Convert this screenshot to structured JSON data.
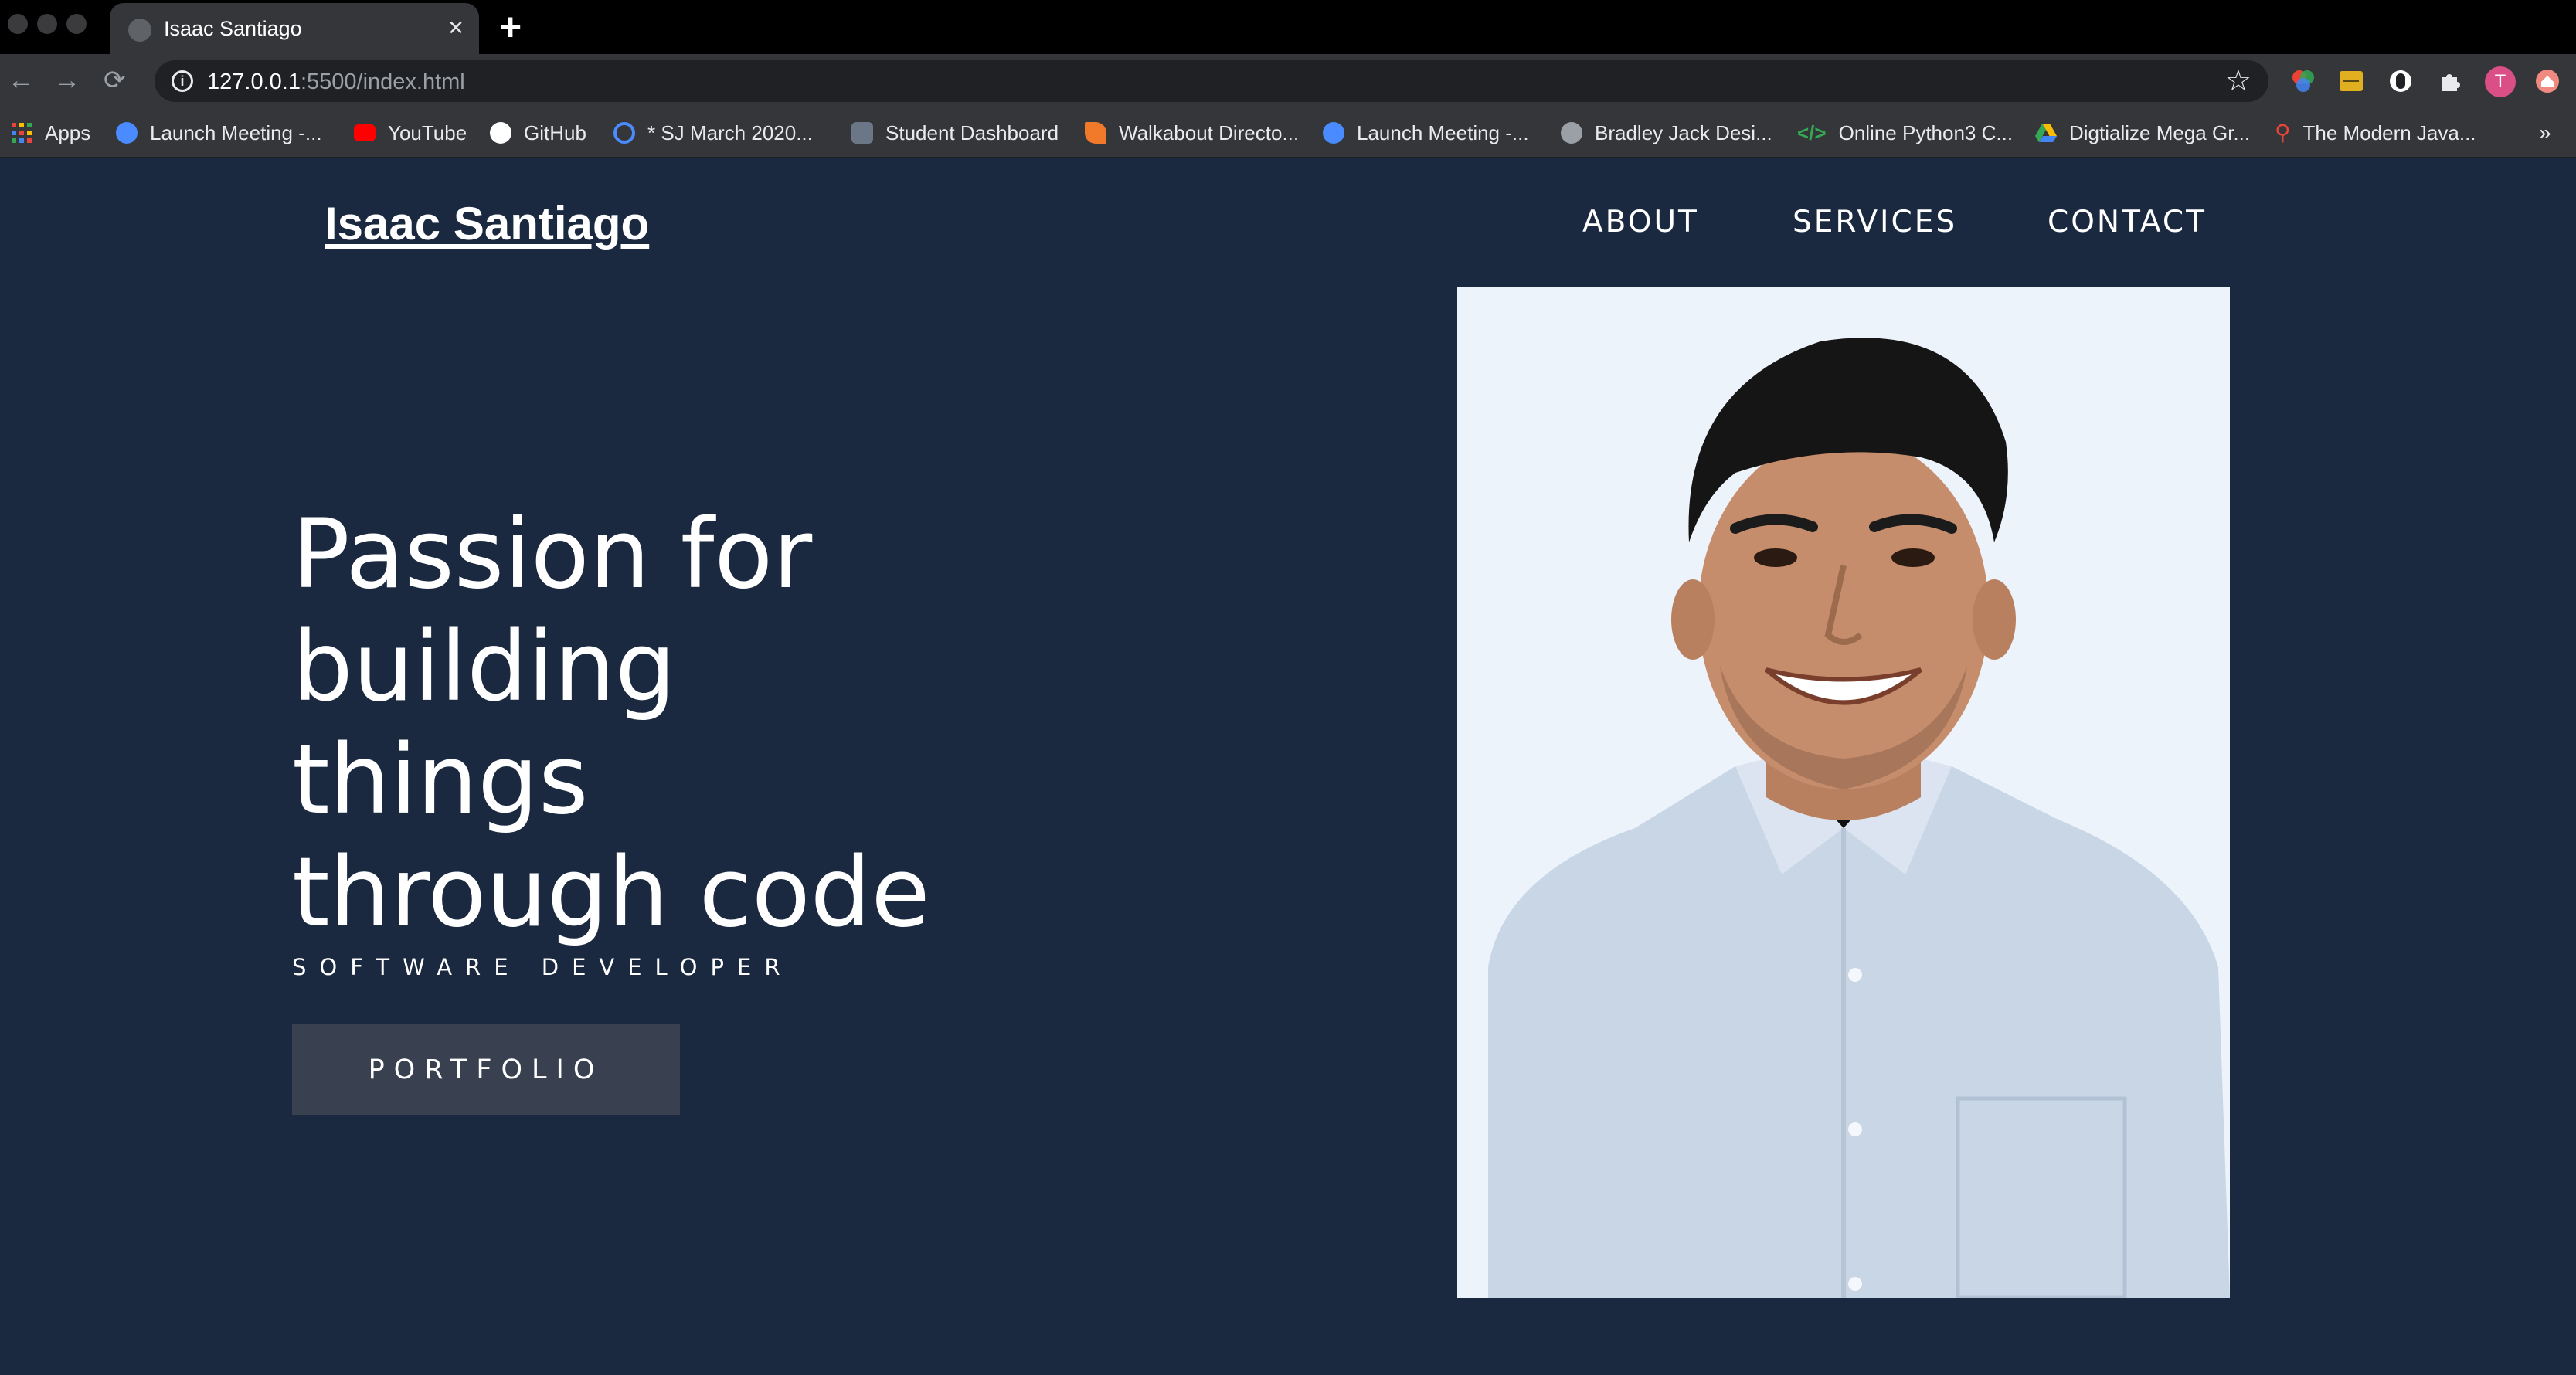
{
  "browser": {
    "tab_title": "Isaac Santiago",
    "tab_close": "×",
    "new_tab": "+",
    "url_host": "127.0.0.1",
    "url_rest": ":5500/index.html",
    "back": "←",
    "forward": "→",
    "reload": "⟳",
    "star": "☆",
    "profile_initial": "T",
    "more_bookmarks": "»",
    "bookmarks": [
      {
        "label": "Apps",
        "icon": "apps-grid-icon",
        "color": "#e8453c"
      },
      {
        "label": "Launch Meeting -...",
        "icon": "zoom-icon",
        "color": "#4a8cff"
      },
      {
        "label": "YouTube",
        "icon": "youtube-icon",
        "color": "#ff0000"
      },
      {
        "label": "GitHub",
        "icon": "github-icon",
        "color": "#ffffff"
      },
      {
        "label": "* SJ March 2020...",
        "icon": "power-icon",
        "color": "#4a8cff"
      },
      {
        "label": "Student Dashboard",
        "icon": "dashboard-icon",
        "color": "#6b7787"
      },
      {
        "label": "Walkabout Directo...",
        "icon": "walkabout-icon",
        "color": "#f07a2a"
      },
      {
        "label": "Launch Meeting -...",
        "icon": "zoom-icon",
        "color": "#4a8cff"
      },
      {
        "label": "Bradley Jack Desi...",
        "icon": "design-icon",
        "color": "#9aa0a6"
      },
      {
        "label": "Online Python3 C...",
        "icon": "code-icon",
        "color": "#34a853"
      },
      {
        "label": "Digtialize Mega Gr...",
        "icon": "google-drive-icon",
        "color": "#fbbc04"
      },
      {
        "label": "The Modern Java...",
        "icon": "java-icon",
        "color": "#e8453c"
      }
    ]
  },
  "site": {
    "brand": "Isaac Santiago",
    "nav": [
      "ABOUT",
      "SERVICES",
      "CONTACT"
    ],
    "hero_lines": [
      "Passion for",
      "building",
      "things",
      "through code"
    ],
    "subtitle": "SOFTWARE DEVELOPER",
    "cta": "PORTFOLIO"
  },
  "colors": {
    "page_bg": "#1a2940",
    "button_bg": "#394150",
    "photo_bg": "#edf3fb"
  }
}
